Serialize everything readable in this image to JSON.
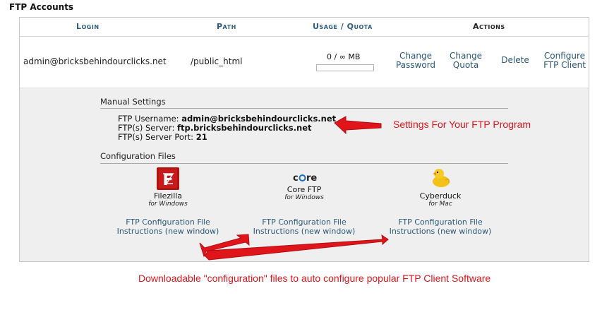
{
  "section_title": "FTP Accounts",
  "table": {
    "headers": {
      "login": "Login",
      "path": "Path",
      "usage": "Usage / Quota",
      "actions": "Actions"
    },
    "row": {
      "login": "admin@bricksbehindourclicks.net",
      "path": "/public_html",
      "usage_text": "0 / ∞ MB",
      "usage_fraction": 0,
      "actions": {
        "change_password": [
          "Change",
          "Password"
        ],
        "change_quota": [
          "Change",
          "Quota"
        ],
        "delete": "Delete",
        "configure": [
          "Configure",
          "FTP Client"
        ]
      }
    }
  },
  "manual": {
    "title": "Manual Settings",
    "username_label": "FTP Username: ",
    "username_value": "admin@bricksbehindourclicks.net",
    "server_label": "FTP(s) Server: ",
    "server_value": "ftp.bricksbehindourclicks.net",
    "port_label": "FTP(s) Server Port: ",
    "port_value": "21"
  },
  "config": {
    "title": "Configuration Files",
    "clients": [
      {
        "name": "Filezilla",
        "platform": "for Windows",
        "icon": "filezilla-icon",
        "instr": [
          "FTP Configuration File",
          "Instructions (new window)"
        ]
      },
      {
        "name": "Core FTP",
        "platform": "for Windows",
        "icon": "coreftp-icon",
        "logo_text": "core",
        "instr": [
          "FTP Configuration File",
          "Instructions (new window)"
        ]
      },
      {
        "name": "Cyberduck",
        "platform": "for Mac",
        "icon": "cyberduck-icon",
        "instr": [
          "FTP Configuration File",
          "Instructions (new window)"
        ]
      }
    ]
  },
  "annotations": {
    "settings_note": "Settings For Your FTP Program",
    "bottom_note": "Downloadable \"configuration\" files to auto configure popular FTP Client Software",
    "color": "#e0151b"
  }
}
